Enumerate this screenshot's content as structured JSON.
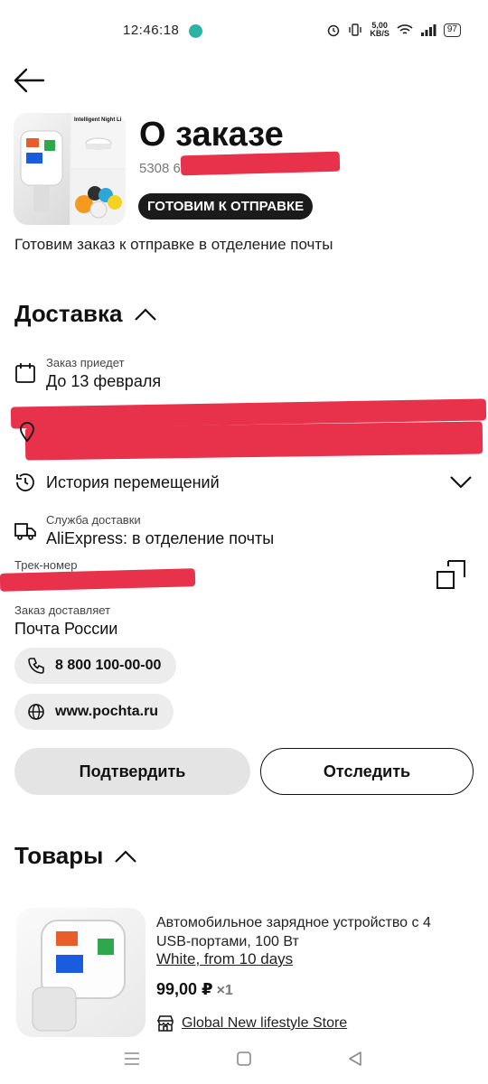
{
  "status_bar": {
    "time": "12:46:18",
    "net_speed_top": "5,00",
    "net_speed_bottom": "KB/S",
    "battery": "97"
  },
  "header": {
    "title": "О заказе",
    "order_number_visible": "5308 63",
    "status_badge": "ГОТОВИМ К ОТПРАВКЕ",
    "description": "Готовим заказ к отправке в отделение почты",
    "thumb_caption": "Intelligent Night Li"
  },
  "delivery": {
    "section_title": "Доставка",
    "arrival_label": "Заказ приедет",
    "arrival_value": "До 13 февраля",
    "history_label": "История перемещений",
    "service_label": "Служба доставки",
    "service_value": "AliExpress: в отделение почты",
    "track_label": "Трек-номер",
    "carrier_label": "Заказ доставляет",
    "carrier_value": "Почта России",
    "phone": "8 800 100-00-00",
    "website": "www.pochta.ru",
    "confirm_button": "Подтвердить",
    "track_button": "Отследить"
  },
  "goods": {
    "section_title": "Товары",
    "items": [
      {
        "title": "Автомобильное зарядное устройство с 4 USB-портами, 100 Вт",
        "variant": "White, from 10 days",
        "price": "99,00 ₽",
        "qty": "×1",
        "store": "Global New lifestyle Store"
      }
    ]
  },
  "colors": {
    "accent_dark": "#1b1b1b",
    "redaction": "#e8314a",
    "chip_bg": "#ececec"
  }
}
